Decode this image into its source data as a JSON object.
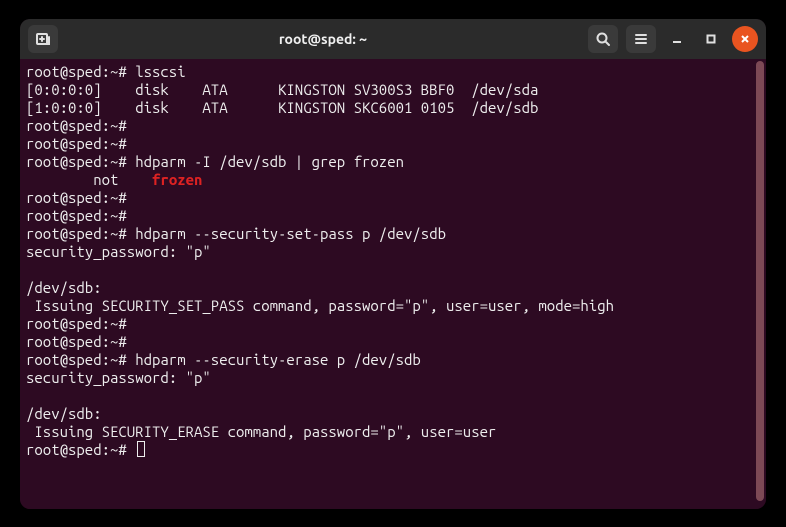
{
  "titlebar": {
    "title": "root@sped: ~"
  },
  "terminal": {
    "lines": [
      {
        "prompt": "root@sped:~# ",
        "cmd": "lsscsi"
      },
      {
        "text": "[0:0:0:0]    disk    ATA      KINGSTON SV300S3 BBF0  /dev/sda"
      },
      {
        "text": "[1:0:0:0]    disk    ATA      KINGSTON SKC6001 0105  /dev/sdb"
      },
      {
        "prompt": "root@sped:~#",
        "cmd": ""
      },
      {
        "prompt": "root@sped:~#",
        "cmd": ""
      },
      {
        "prompt": "root@sped:~# ",
        "cmd": "hdparm -I /dev/sdb | grep frozen"
      },
      {
        "pre": "        not    ",
        "hl": "frozen"
      },
      {
        "prompt": "root@sped:~#",
        "cmd": ""
      },
      {
        "prompt": "root@sped:~#",
        "cmd": ""
      },
      {
        "prompt": "root@sped:~# ",
        "cmd": "hdparm --security-set-pass p /dev/sdb"
      },
      {
        "text": "security_password: \"p\""
      },
      {
        "text": ""
      },
      {
        "text": "/dev/sdb:"
      },
      {
        "text": " Issuing SECURITY_SET_PASS command, password=\"p\", user=user, mode=high"
      },
      {
        "prompt": "root@sped:~#",
        "cmd": ""
      },
      {
        "prompt": "root@sped:~#",
        "cmd": ""
      },
      {
        "prompt": "root@sped:~# ",
        "cmd": "hdparm --security-erase p /dev/sdb"
      },
      {
        "text": "security_password: \"p\""
      },
      {
        "text": ""
      },
      {
        "text": "/dev/sdb:"
      },
      {
        "text": " Issuing SECURITY_ERASE command, password=\"p\", user=user"
      },
      {
        "prompt": "root@sped:~# ",
        "cmd": "",
        "cursor": true
      }
    ]
  }
}
